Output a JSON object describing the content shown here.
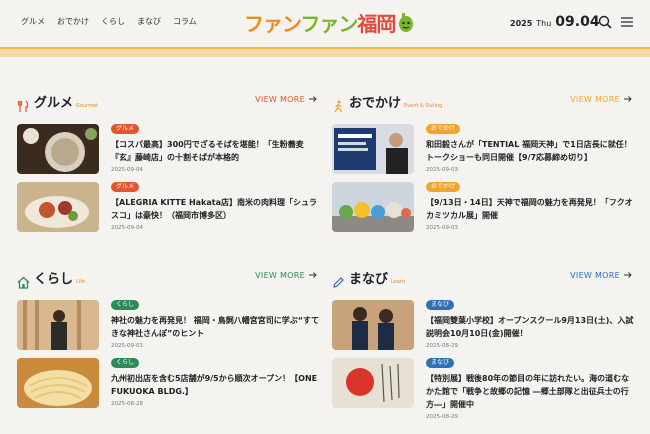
{
  "header": {
    "nav": [
      "グルメ",
      "おでかけ",
      "くらし",
      "まなび",
      "コラム"
    ],
    "logo": {
      "part1": "ファン",
      "part2": "ファン",
      "part3": "福岡"
    },
    "date": {
      "year": "2025",
      "weekday": "Thu",
      "monthday": "09.04"
    },
    "icons": [
      "search-icon",
      "menu-icon"
    ]
  },
  "colors": {
    "gourmet": "#e2562f",
    "odekake": "#f0a531",
    "kurashi": "#2e8b57",
    "manabi": "#2f6fb4",
    "header_bar": "#f7d9a6"
  },
  "sections": {
    "gourmet": {
      "title": "グルメ",
      "en": "Gourmet",
      "view_more": "VIEW MORE",
      "icon": "fork-knife-icon",
      "items": [
        {
          "badge": "グルメ",
          "title": "【コスパ最高】300円でざるそばを堪能！「生粉蕎麦『玄』藤崎店」の十割そばが本格的",
          "date": "2025-09-04"
        },
        {
          "badge": "グルメ",
          "title": "【ALEGRIA KITTE Hakata店】南米の肉料理「シュラスコ」は豪快！（福岡市博多区）",
          "date": "2025-09-04"
        }
      ]
    },
    "odekake": {
      "title": "おでかけ",
      "en": "Event & Outing",
      "view_more": "VIEW MORE",
      "icon": "walker-icon",
      "items": [
        {
          "badge": "おでかけ",
          "title": "和田毅さんが「TENTIAL 福岡天神」で1日店長に就任！ トークショーも同日開催【9/7応募締め切り】",
          "date": "2025-09-03"
        },
        {
          "badge": "おでかけ",
          "title": "【9/13日・14日】天神で福岡の魅力を再発見！「フクオカミツカル展」開催",
          "date": "2025-09-03"
        }
      ]
    },
    "kurashi": {
      "title": "くらし",
      "en": "Life",
      "view_more": "VIEW MORE",
      "icon": "house-icon",
      "items": [
        {
          "badge": "くらし",
          "title": "神社の魅力を再発見！ 福岡・鳥飼八幡宮宮司に学ぶ“すてきな神社さんぽ”のヒント",
          "date": "2025-09-03"
        },
        {
          "badge": "くらし",
          "title": "九州初出店を含む5店舗が9/5から順次オープン！【ONE FUKUOKA BLDG.】",
          "date": "2025-08-28"
        }
      ]
    },
    "manabi": {
      "title": "まなび",
      "en": "Learn",
      "view_more": "VIEW MORE",
      "icon": "pencil-icon",
      "items": [
        {
          "badge": "まなび",
          "title": "【福岡雙葉小学校】オープンスクール9月13日(土)、入試説明会10月10日(金)開催！",
          "date": "2025-08-29"
        },
        {
          "badge": "まなび",
          "title": "【特別展】戦後80年の節目の年に訪れたい。海の道むなかた館で「戦争と故郷の記憶 ―郷土部隊と出征兵士の行方―」開催中",
          "date": "2025-08-29"
        }
      ]
    }
  }
}
